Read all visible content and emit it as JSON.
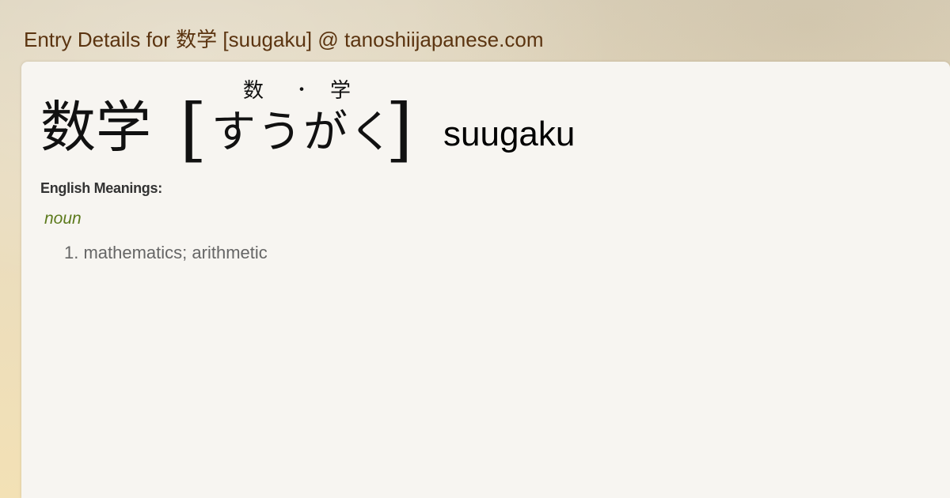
{
  "header": {
    "title": "Entry Details for 数学 [suugaku] @ tanoshiijapanese.com"
  },
  "entry": {
    "kanji": "数学",
    "bracket_open": "[",
    "bracket_close": "]",
    "furigana": [
      "数",
      "・",
      "学"
    ],
    "reading_kana": "すうがく",
    "romaji": "suugaku"
  },
  "meanings": {
    "heading": "English Meanings:",
    "part_of_speech": "noun",
    "items": [
      "1. mathematics; arithmetic"
    ]
  }
}
